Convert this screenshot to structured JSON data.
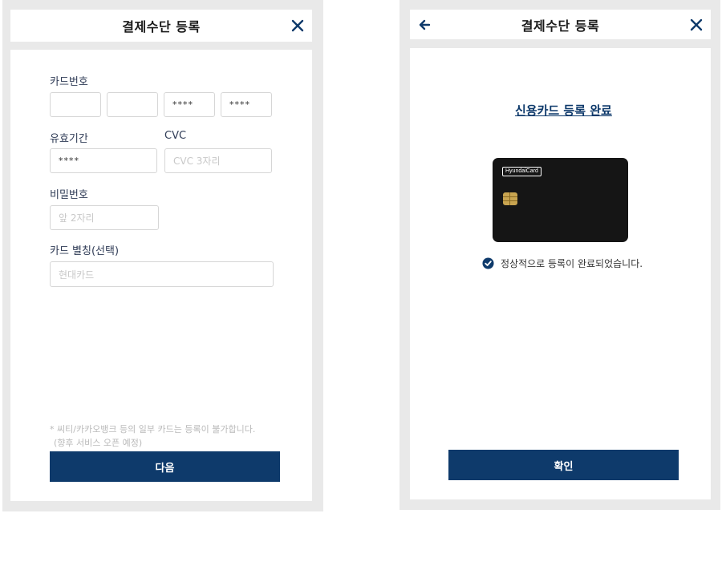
{
  "left_screen": {
    "header": {
      "title": "결제수단 등록",
      "close_icon": "close-icon"
    },
    "card_number": {
      "label": "카드번호",
      "fields": [
        {
          "value": ""
        },
        {
          "value": ""
        },
        {
          "value": "****"
        },
        {
          "value": "****"
        }
      ]
    },
    "expiry": {
      "label": "유효기간",
      "value": "****"
    },
    "cvc": {
      "label": "CVC",
      "placeholder": "CVC 3자리"
    },
    "password": {
      "label": "비밀번호",
      "placeholder": "앞 2자리"
    },
    "nickname": {
      "label": "카드 별칭(선택)",
      "placeholder": "현대카드"
    },
    "notice_line1": "* 씨티/카카오뱅크 등의 일부 카드는 등록이 불가합니다.",
    "notice_line2": "(향후 서비스 오픈 예정)",
    "next_button": "다음"
  },
  "right_screen": {
    "header": {
      "title": "결제수단 등록",
      "back_icon": "arrow-left-icon",
      "close_icon": "close-icon"
    },
    "complete_title": "신용카드 등록 완료",
    "card_brand": "HyundaiCard",
    "success_message": "정상적으로 등록이 완료되었습니다.",
    "confirm_button": "확인"
  },
  "colors": {
    "primary": "#0e3a6b",
    "frame": "#e9e9e9",
    "card": "#151515"
  }
}
